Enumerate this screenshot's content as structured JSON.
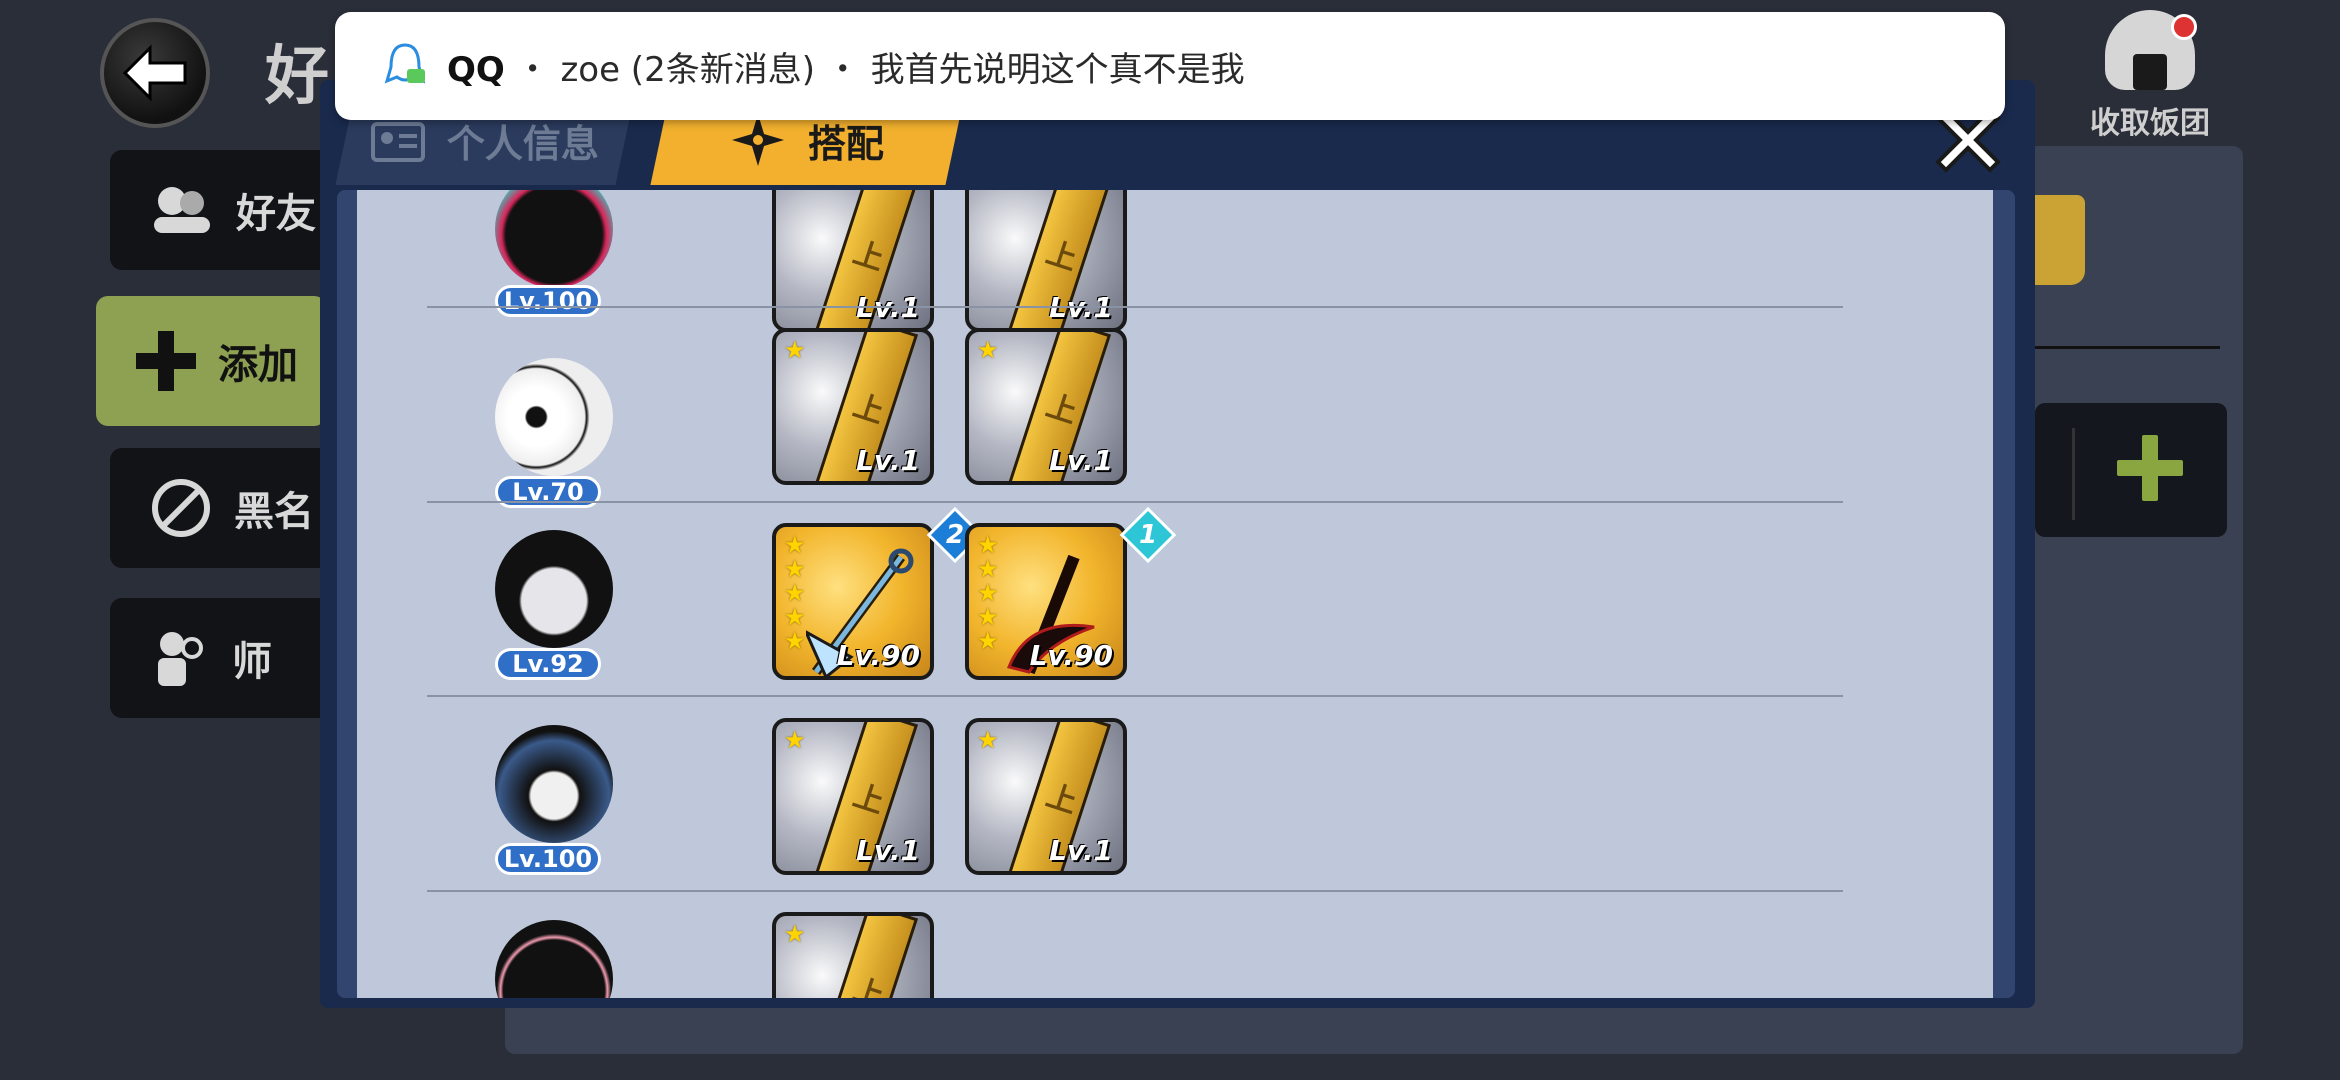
{
  "background": {
    "title": "好",
    "sidebar": [
      {
        "label": "好友",
        "icon": "friends-icon"
      },
      {
        "label": "添加",
        "icon": "plus-icon"
      },
      {
        "label": "黑名",
        "icon": "block-icon"
      },
      {
        "label": "师",
        "icon": "mentor-icon"
      }
    ],
    "collect_label": "收取饭团"
  },
  "notification": {
    "app": "QQ",
    "separator1": "・",
    "sender": "zoe (2条新消息)",
    "separator2": "・",
    "message": "我首先说明这个真不是我"
  },
  "modal": {
    "tabs": [
      {
        "label": "个人信息",
        "icon": "profile-card-icon"
      },
      {
        "label": "搭配",
        "icon": "shuriken-icon"
      }
    ],
    "rows": [
      {
        "hero_level": "Lv.100",
        "weapons": [
          {
            "level": "Lv.1",
            "stars": 0
          },
          {
            "level": "Lv.1",
            "stars": 0
          }
        ]
      },
      {
        "hero_level": "Lv.70",
        "weapons": [
          {
            "level": "Lv.1",
            "stars": 1
          },
          {
            "level": "Lv.1",
            "stars": 1
          }
        ]
      },
      {
        "hero_level": "Lv.92",
        "weapons": [
          {
            "level": "Lv.90",
            "stars": 5,
            "gem": "2"
          },
          {
            "level": "Lv.90",
            "stars": 5,
            "gem": "1"
          }
        ]
      },
      {
        "hero_level": "Lv.100",
        "weapons": [
          {
            "level": "Lv.1",
            "stars": 1
          },
          {
            "level": "Lv.1",
            "stars": 1
          }
        ]
      },
      {
        "hero_level": "",
        "weapons": [
          {
            "level": "",
            "stars": 1
          }
        ]
      }
    ]
  }
}
